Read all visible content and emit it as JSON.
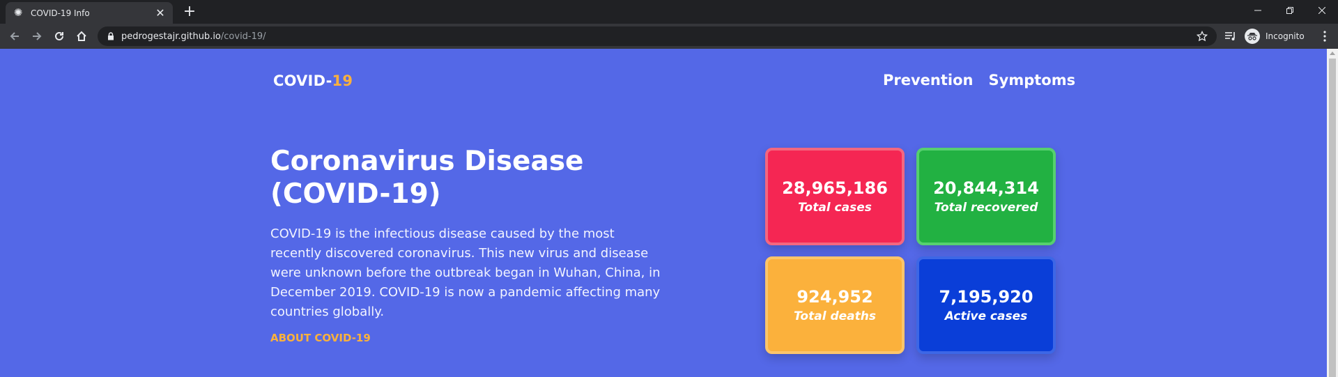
{
  "browser": {
    "tab_title": "COVID-19 Info",
    "tab_close": "✕",
    "new_tab": "+",
    "url_host": "pedrogestajr.github.io",
    "url_path": "/covid-19/",
    "profile_label": "Incognito"
  },
  "page": {
    "logo_main": "COVID-",
    "logo_accent": "19",
    "nav": [
      "Prevention",
      "Symptoms"
    ],
    "hero_title": "Coronavirus Disease (COVID-19)",
    "hero_text": "COVID-19 is the infectious disease caused by the most recently discovered coronavirus. This new virus and disease were unknown before the outbreak began in Wuhan, China, in December 2019. COVID-19 is now a pandemic affecting many countries globally.",
    "about_link": "ABOUT COVID-19",
    "stats": [
      {
        "value": "28,965,186",
        "label": "Total cases",
        "color": "#f52653",
        "border": "#f4677f"
      },
      {
        "value": "20,844,314",
        "label": "Total recovered",
        "color": "#22b142",
        "border": "#56d06f"
      },
      {
        "value": "924,952",
        "label": "Total deaths",
        "color": "#fbb13c",
        "border": "#fcc56b"
      },
      {
        "value": "7,195,920",
        "label": "Active cases",
        "color": "#0a3ed8",
        "border": "#3d67e6"
      }
    ]
  },
  "colors": {
    "page_bg": "#5468e7",
    "accent": "#fbb13c",
    "chrome_dark": "#202124",
    "chrome_toolbar": "#35363a"
  },
  "icons": {
    "favicon": "virus-icon",
    "back": "back-arrow-icon",
    "forward": "forward-arrow-icon",
    "reload": "reload-icon",
    "home": "home-icon",
    "lock": "lock-icon",
    "bookmark": "star-icon",
    "media": "media-queue-icon",
    "incognito": "incognito-icon",
    "menu": "kebab-menu-icon"
  }
}
